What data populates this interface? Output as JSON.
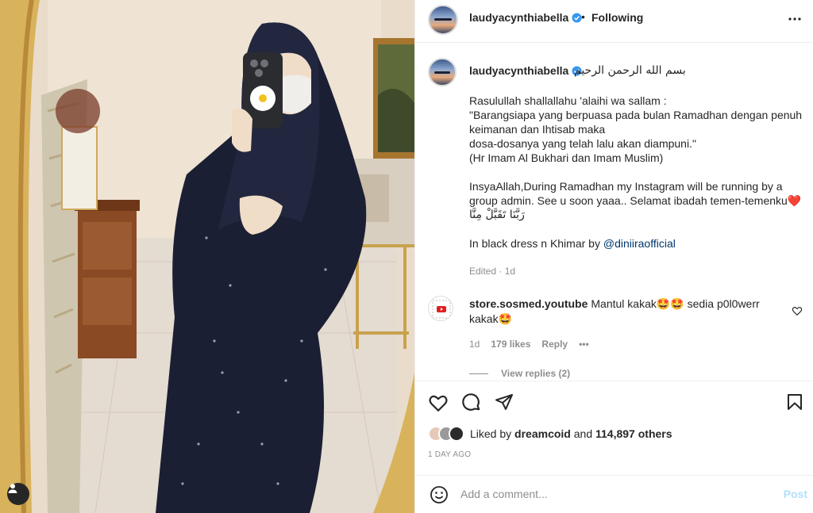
{
  "header": {
    "username": "laudyacynthiabella",
    "separator": "•",
    "follow_state": "Following",
    "verified_icon": "verified-badge-icon",
    "more_icon": "more-options-icon"
  },
  "caption": {
    "username": "laudyacynthiabella",
    "arabic": "بسم الله الرحمن الرحيم",
    "lines": [
      "Rasulullah shallallahu 'alaihi wa sallam :",
      "\"Barangsiapa yang berpuasa pada bulan Ramadhan dengan penuh keimanan dan Ihtisab maka",
      "dosa-dosanya yang telah lalu akan diampuni.\"",
      "(Hr Imam Al Bukhari dan Imam Muslim)"
    ],
    "para2": "InsyaAllah,During Ramadhan my Instagram will be running by a group admin. See u soon yaaa.. Selamat ibadah temen-temenku❤️",
    "para2_arabic": "رَبَّنَا تَقَبَّلْ مِنَّا",
    "para3_prefix": "In black dress n Khimar by ",
    "para3_mention": "@diniiraofficial",
    "edited": "Edited",
    "meta_sep": "·",
    "time": "1d"
  },
  "comment": {
    "username": "store.sosmed.youtube",
    "text": "Mantul kakak🤩🤩 sedia p0l0werr kakak🤩",
    "time": "1d",
    "likes": "179 likes",
    "reply": "Reply",
    "more": "•••",
    "view_replies": "View replies (2)"
  },
  "actions": {
    "like_icon": "heart-icon",
    "comment_icon": "comment-icon",
    "share_icon": "share-icon",
    "save_icon": "bookmark-icon"
  },
  "likes": {
    "prefix": "Liked by ",
    "user": "dreamcoid",
    "middle": " and ",
    "count": "114,897 others"
  },
  "posted_ago": "1 DAY AGO",
  "add_comment": {
    "placeholder": "Add a comment...",
    "post_label": "Post"
  }
}
